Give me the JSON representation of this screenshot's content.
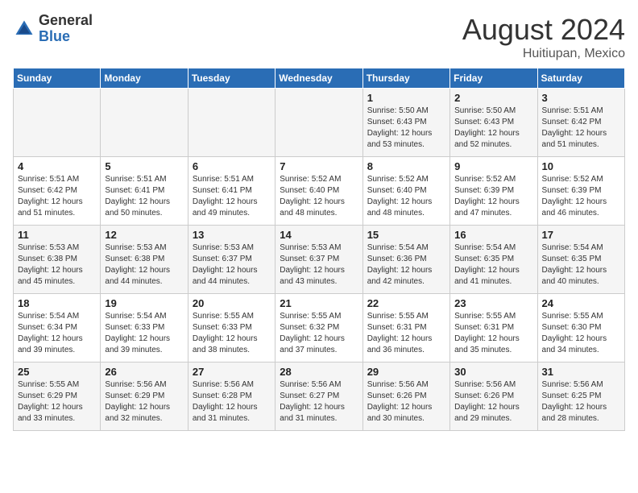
{
  "logo": {
    "general": "General",
    "blue": "Blue"
  },
  "title": "August 2024",
  "location": "Huitiupan, Mexico",
  "days_of_week": [
    "Sunday",
    "Monday",
    "Tuesday",
    "Wednesday",
    "Thursday",
    "Friday",
    "Saturday"
  ],
  "weeks": [
    [
      {
        "day": "",
        "info": ""
      },
      {
        "day": "",
        "info": ""
      },
      {
        "day": "",
        "info": ""
      },
      {
        "day": "",
        "info": ""
      },
      {
        "day": "1",
        "info": "Sunrise: 5:50 AM\nSunset: 6:43 PM\nDaylight: 12 hours and 53 minutes."
      },
      {
        "day": "2",
        "info": "Sunrise: 5:50 AM\nSunset: 6:43 PM\nDaylight: 12 hours and 52 minutes."
      },
      {
        "day": "3",
        "info": "Sunrise: 5:51 AM\nSunset: 6:42 PM\nDaylight: 12 hours and 51 minutes."
      }
    ],
    [
      {
        "day": "4",
        "info": "Sunrise: 5:51 AM\nSunset: 6:42 PM\nDaylight: 12 hours and 51 minutes."
      },
      {
        "day": "5",
        "info": "Sunrise: 5:51 AM\nSunset: 6:41 PM\nDaylight: 12 hours and 50 minutes."
      },
      {
        "day": "6",
        "info": "Sunrise: 5:51 AM\nSunset: 6:41 PM\nDaylight: 12 hours and 49 minutes."
      },
      {
        "day": "7",
        "info": "Sunrise: 5:52 AM\nSunset: 6:40 PM\nDaylight: 12 hours and 48 minutes."
      },
      {
        "day": "8",
        "info": "Sunrise: 5:52 AM\nSunset: 6:40 PM\nDaylight: 12 hours and 48 minutes."
      },
      {
        "day": "9",
        "info": "Sunrise: 5:52 AM\nSunset: 6:39 PM\nDaylight: 12 hours and 47 minutes."
      },
      {
        "day": "10",
        "info": "Sunrise: 5:52 AM\nSunset: 6:39 PM\nDaylight: 12 hours and 46 minutes."
      }
    ],
    [
      {
        "day": "11",
        "info": "Sunrise: 5:53 AM\nSunset: 6:38 PM\nDaylight: 12 hours and 45 minutes."
      },
      {
        "day": "12",
        "info": "Sunrise: 5:53 AM\nSunset: 6:38 PM\nDaylight: 12 hours and 44 minutes."
      },
      {
        "day": "13",
        "info": "Sunrise: 5:53 AM\nSunset: 6:37 PM\nDaylight: 12 hours and 44 minutes."
      },
      {
        "day": "14",
        "info": "Sunrise: 5:53 AM\nSunset: 6:37 PM\nDaylight: 12 hours and 43 minutes."
      },
      {
        "day": "15",
        "info": "Sunrise: 5:54 AM\nSunset: 6:36 PM\nDaylight: 12 hours and 42 minutes."
      },
      {
        "day": "16",
        "info": "Sunrise: 5:54 AM\nSunset: 6:35 PM\nDaylight: 12 hours and 41 minutes."
      },
      {
        "day": "17",
        "info": "Sunrise: 5:54 AM\nSunset: 6:35 PM\nDaylight: 12 hours and 40 minutes."
      }
    ],
    [
      {
        "day": "18",
        "info": "Sunrise: 5:54 AM\nSunset: 6:34 PM\nDaylight: 12 hours and 39 minutes."
      },
      {
        "day": "19",
        "info": "Sunrise: 5:54 AM\nSunset: 6:33 PM\nDaylight: 12 hours and 39 minutes."
      },
      {
        "day": "20",
        "info": "Sunrise: 5:55 AM\nSunset: 6:33 PM\nDaylight: 12 hours and 38 minutes."
      },
      {
        "day": "21",
        "info": "Sunrise: 5:55 AM\nSunset: 6:32 PM\nDaylight: 12 hours and 37 minutes."
      },
      {
        "day": "22",
        "info": "Sunrise: 5:55 AM\nSunset: 6:31 PM\nDaylight: 12 hours and 36 minutes."
      },
      {
        "day": "23",
        "info": "Sunrise: 5:55 AM\nSunset: 6:31 PM\nDaylight: 12 hours and 35 minutes."
      },
      {
        "day": "24",
        "info": "Sunrise: 5:55 AM\nSunset: 6:30 PM\nDaylight: 12 hours and 34 minutes."
      }
    ],
    [
      {
        "day": "25",
        "info": "Sunrise: 5:55 AM\nSunset: 6:29 PM\nDaylight: 12 hours and 33 minutes."
      },
      {
        "day": "26",
        "info": "Sunrise: 5:56 AM\nSunset: 6:29 PM\nDaylight: 12 hours and 32 minutes."
      },
      {
        "day": "27",
        "info": "Sunrise: 5:56 AM\nSunset: 6:28 PM\nDaylight: 12 hours and 31 minutes."
      },
      {
        "day": "28",
        "info": "Sunrise: 5:56 AM\nSunset: 6:27 PM\nDaylight: 12 hours and 31 minutes."
      },
      {
        "day": "29",
        "info": "Sunrise: 5:56 AM\nSunset: 6:26 PM\nDaylight: 12 hours and 30 minutes."
      },
      {
        "day": "30",
        "info": "Sunrise: 5:56 AM\nSunset: 6:26 PM\nDaylight: 12 hours and 29 minutes."
      },
      {
        "day": "31",
        "info": "Sunrise: 5:56 AM\nSunset: 6:25 PM\nDaylight: 12 hours and 28 minutes."
      }
    ]
  ]
}
